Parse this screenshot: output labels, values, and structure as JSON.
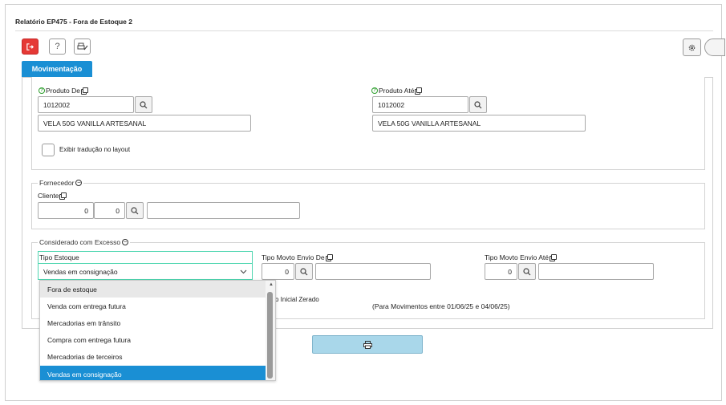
{
  "window": {
    "title": "Relatório EP475 - Fora de Estoque 2"
  },
  "toolbar": {
    "exit_icon": "exit-icon",
    "help_label": "?",
    "print_setup_icon": "printer-config-icon",
    "settings_icon": "gear-icon",
    "exit_color": "#e53935"
  },
  "tabs": [
    {
      "label": "Movimentação",
      "active": true
    }
  ],
  "produto": {
    "de": {
      "label": "Produto De",
      "code": "1012002",
      "description": "VELA 50G VANILLA ARTESANAL"
    },
    "ate": {
      "label": "Produto Até",
      "code": "1012002",
      "description": "VELA 50G VANILLA ARTESANAL"
    },
    "traducao_label": "Exibir tradução no layout"
  },
  "fornecedor": {
    "legend": "Fornecedor",
    "cliente_label": "Cliente",
    "cliente_code1": "0",
    "cliente_code2": "0",
    "cliente_name": ""
  },
  "excesso": {
    "legend": "Considerado com Excesso",
    "tipo_estoque_label": "Tipo Estoque",
    "tipo_estoque_value": "Vendas em consignação",
    "tipo_estoque_options": [
      "Fora de estoque",
      "Venda com entrega futura",
      "Mercadorias em trânsito",
      "Compra com entrega futura",
      "Mercadorias de terceiros",
      "Vendas em consignação"
    ],
    "tipo_movto_de_label": "Tipo Movto Envio De",
    "tipo_movto_de_value": "0",
    "tipo_movto_ate_label": "Tipo Movto Envio Até",
    "tipo_movto_ate_value": "0",
    "saldo_label_partial": "o Inicial Zerado",
    "periodo_note": "(Para Movimentos entre 01/06/25 e 04/06/25)"
  },
  "actions": {
    "print_icon": "printer-icon"
  },
  "colors": {
    "accent": "#1a8fd4",
    "focus": "#4fd6b0"
  }
}
